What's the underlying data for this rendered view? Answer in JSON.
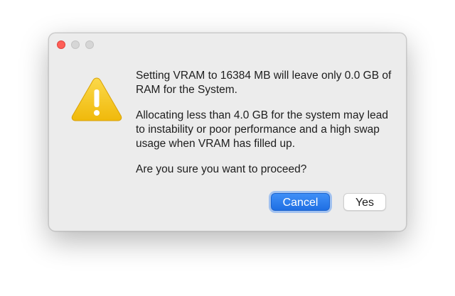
{
  "window": {
    "controls": {
      "close": "close-button",
      "minimize": "minimize-button",
      "zoom": "zoom-button"
    }
  },
  "alert": {
    "icon": "warning-triangle-icon",
    "icon_color": "#f5c71a",
    "message_line1": "Setting VRAM to 16384 MB will leave only 0.0 GB of RAM for the System.",
    "message_line2": "Allocating less than 4.0 GB for the system may lead to instability or poor performance and a high swap usage when VRAM has filled up.",
    "message_line3": "Are you sure you want to proceed?"
  },
  "buttons": {
    "cancel_label": "Cancel",
    "yes_label": "Yes",
    "accent_color": "#2a7cf0"
  }
}
